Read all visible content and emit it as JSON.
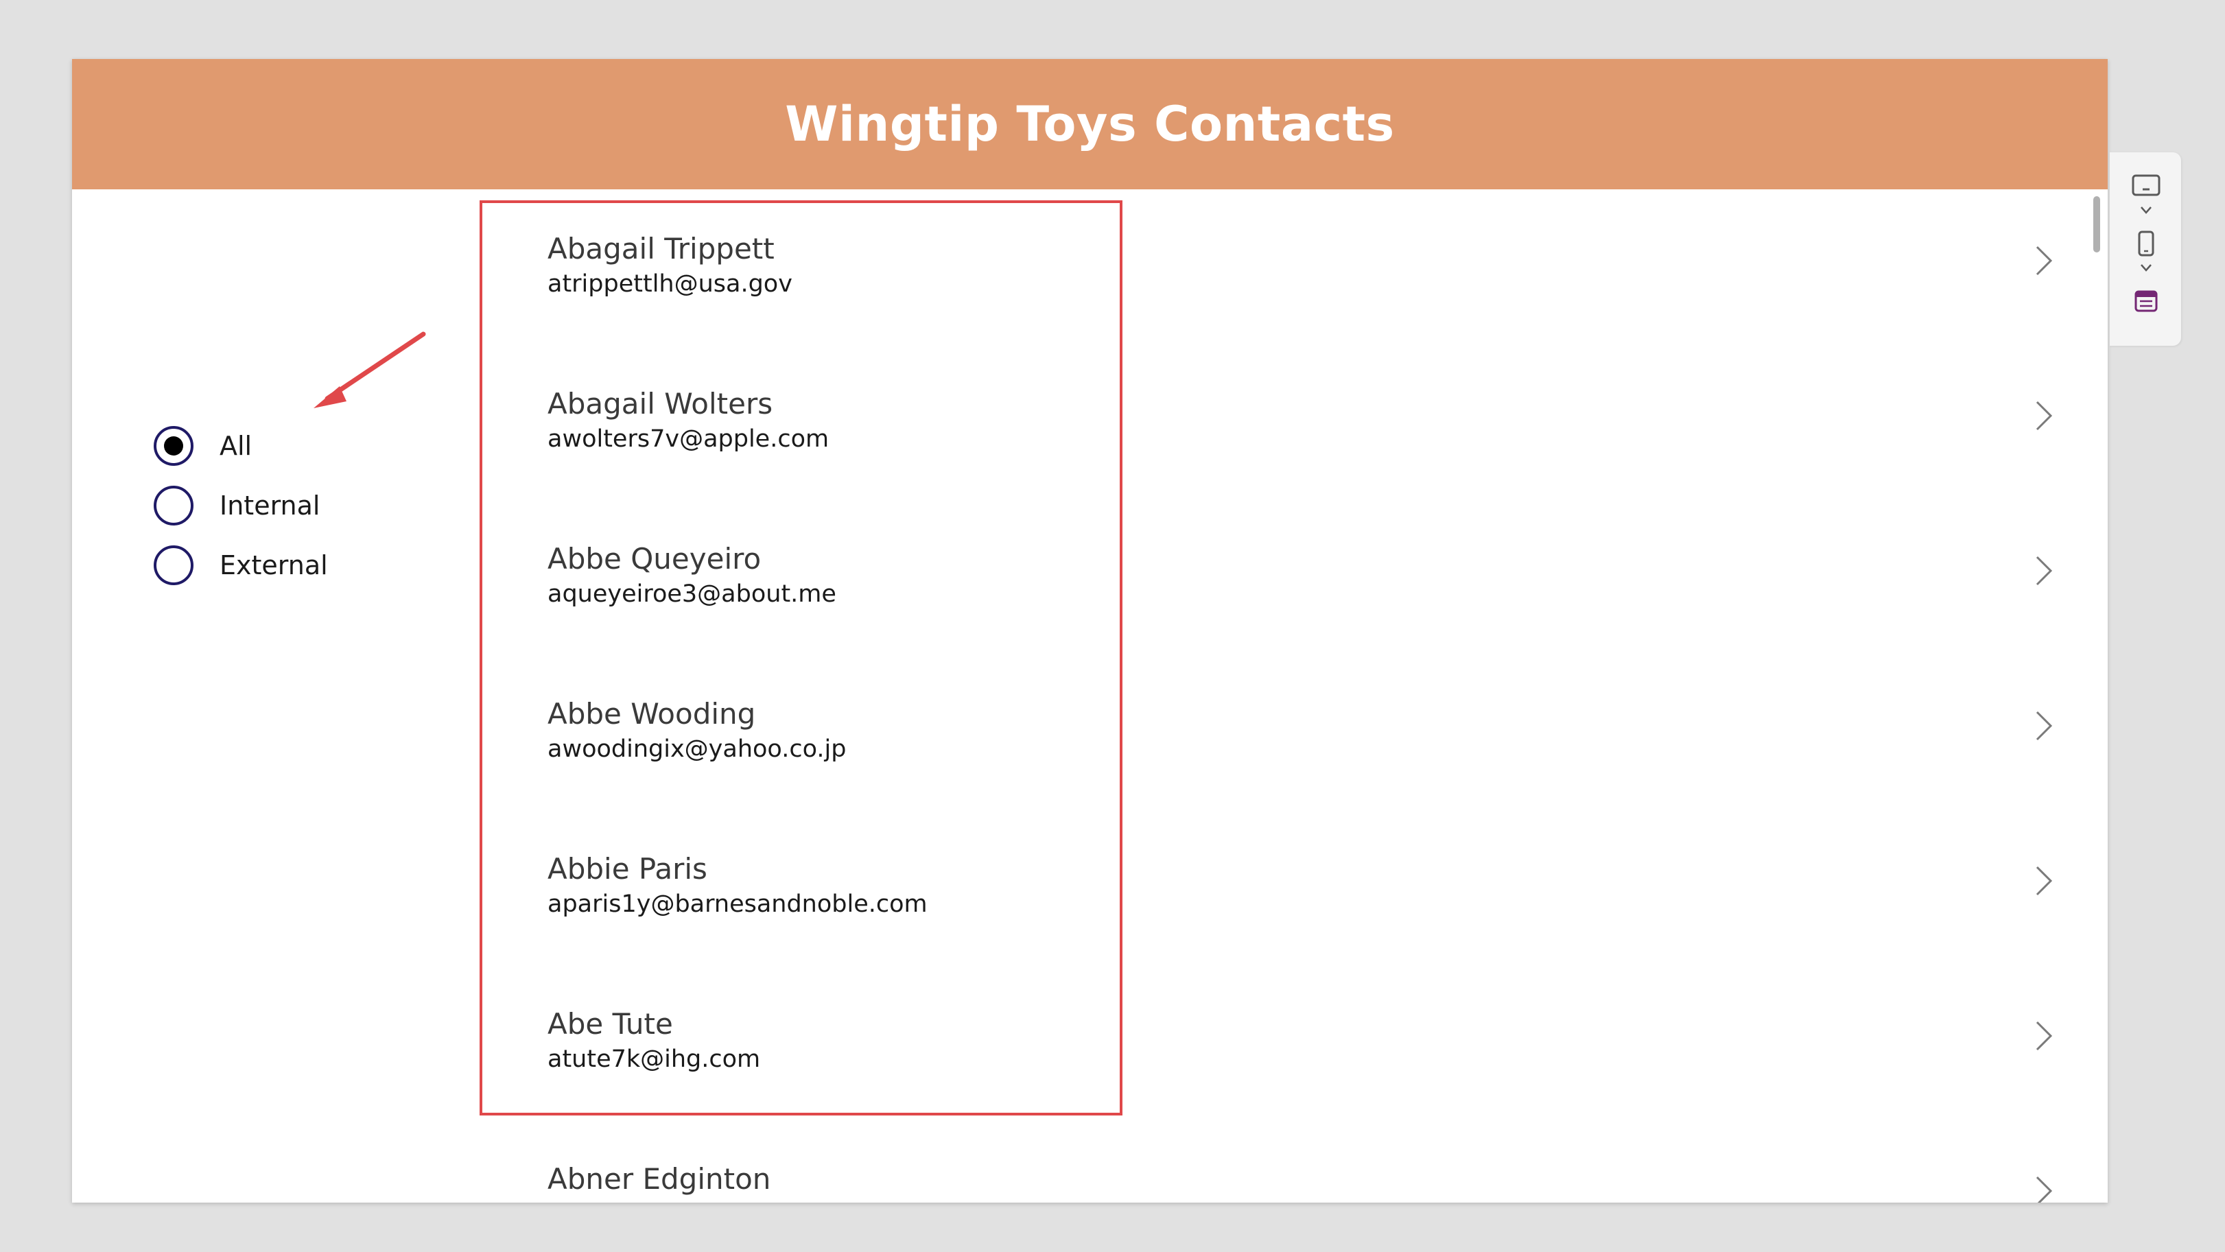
{
  "app": {
    "title": "Wingtip Toys Contacts",
    "header_color": "#e09a6f",
    "accent_color": "#1f1a66",
    "highlight_color": "#e0484a"
  },
  "filter": {
    "options": [
      {
        "label": "All",
        "selected": true
      },
      {
        "label": "Internal",
        "selected": false
      },
      {
        "label": "External",
        "selected": false
      }
    ]
  },
  "gallery": {
    "items": [
      {
        "name": "Abagail Trippett",
        "email": "atrippettlh@usa.gov"
      },
      {
        "name": "Abagail Wolters",
        "email": "awolters7v@apple.com"
      },
      {
        "name": "Abbe Queyeiro",
        "email": "aqueyeiroe3@about.me"
      },
      {
        "name": "Abbe Wooding",
        "email": "awoodingix@yahoo.co.jp"
      },
      {
        "name": "Abbie Paris",
        "email": "aparis1y@barnesandnoble.com"
      },
      {
        "name": "Abe Tute",
        "email": "atute7k@ihg.com"
      },
      {
        "name": "Abner Edginton",
        "email": ""
      }
    ]
  },
  "toolbar": {
    "icons": [
      "screen-size-icon",
      "chevron-down-icon",
      "phone-icon",
      "chevron-down-icon",
      "app-settings-icon"
    ]
  }
}
